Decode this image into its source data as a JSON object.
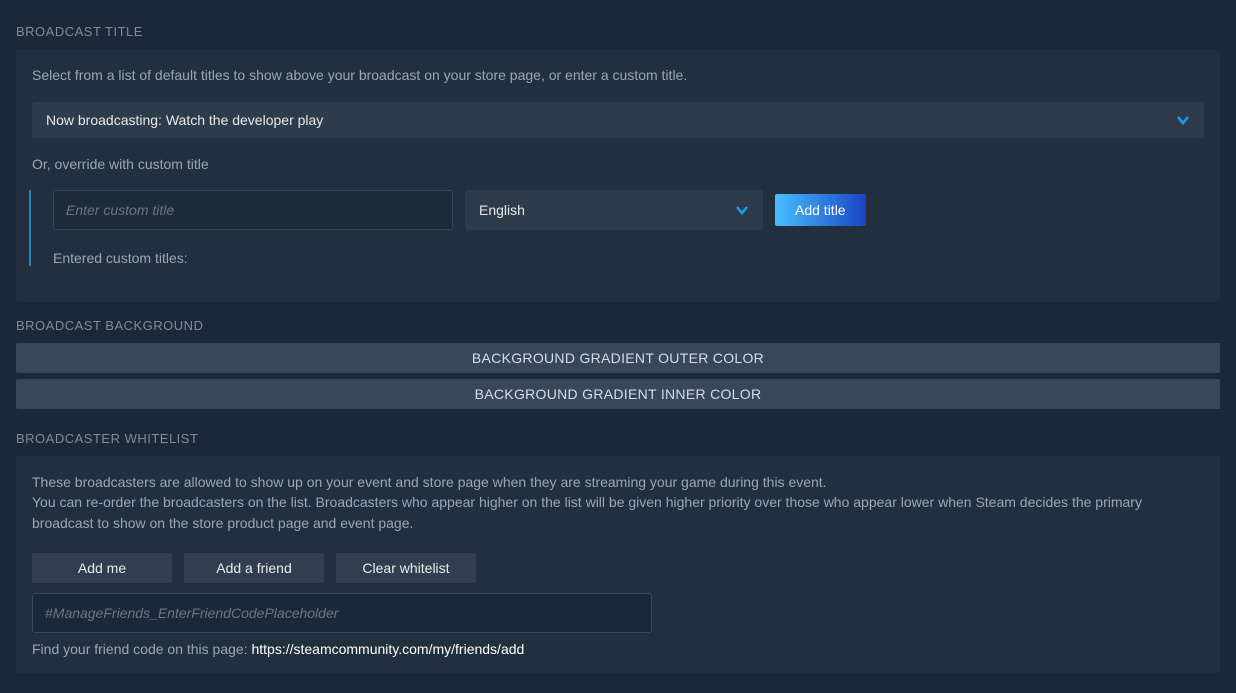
{
  "broadcastTitle": {
    "header": "BROADCAST TITLE",
    "description": "Select from a list of default titles to show above your broadcast on your store page, or enter a custom title.",
    "selectedTitle": "Now broadcasting: Watch the developer play",
    "overrideLabel": "Or, override with custom title",
    "customTitlePlaceholder": "Enter custom title",
    "languageSelected": "English",
    "addTitleBtn": "Add title",
    "enteredLabel": "Entered custom titles:"
  },
  "broadcastBackground": {
    "header": "BROADCAST BACKGROUND",
    "outerBtn": "BACKGROUND GRADIENT OUTER COLOR",
    "innerBtn": "BACKGROUND GRADIENT INNER COLOR"
  },
  "broadcasterWhitelist": {
    "header": "BROADCASTER WHITELIST",
    "desc1": "These broadcasters are allowed to show up on your event and store page when they are streaming your game during this event.",
    "desc2": "You can re-order the broadcasters on the list. Broadcasters who appear higher on the list will be given higher priority over those who appear lower when Steam decides the primary broadcast to show on the store product page and event page.",
    "addMeBtn": "Add me",
    "addFriendBtn": "Add a friend",
    "clearBtn": "Clear whitelist",
    "friendCodePlaceholder": "#ManageFriends_EnterFriendCodePlaceholder",
    "helpPrefix": "Find your friend code on this page: ",
    "helpLink": "https://steamcommunity.com/my/friends/add"
  }
}
